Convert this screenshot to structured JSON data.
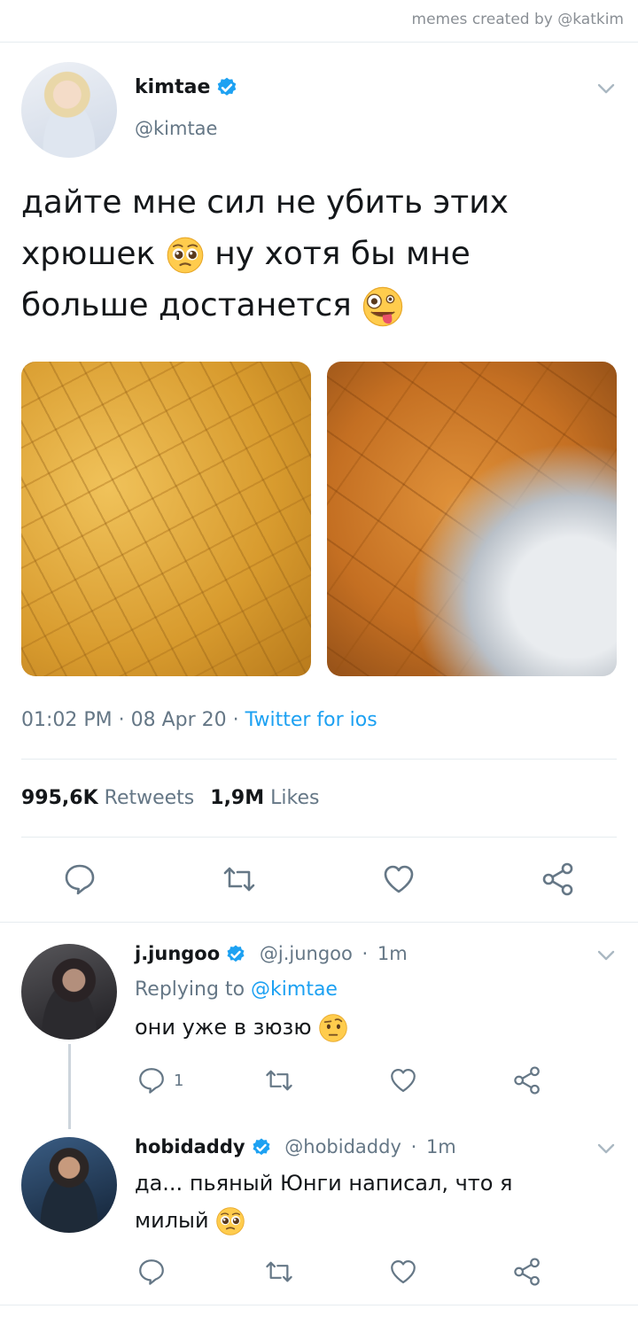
{
  "credit": "memes created by @katkim",
  "tweet": {
    "name": "kimtae",
    "handle": "@kimtae",
    "text_line1": "дайте мне сил не убить этих",
    "text_line2a": "хрюшек",
    "text_line2b": "ну хотя бы мне",
    "text_line3": "больше достанется",
    "time": "01:02 PM",
    "date": "08 Apr 20",
    "source": "Twitter for ios",
    "retweets_count": "995,6K",
    "retweets_label": "Retweets",
    "likes_count": "1,9M",
    "likes_label": "Likes"
  },
  "replies": [
    {
      "name": "j.jungoo",
      "handle": "@j.jungoo",
      "age": "1m",
      "replying_label": "Replying to",
      "replying_to": "@kimtae",
      "text": "они уже в зюзю",
      "reply_count": "1"
    },
    {
      "name": "hobidaddy",
      "handle": "@hobidaddy",
      "age": "1m",
      "text_line1": "да... пьяный Юнги написал, что я",
      "text_line2": "милый"
    }
  ],
  "icons": {
    "verified": "verified-badge-icon",
    "reply": "reply-icon",
    "retweet": "retweet-icon",
    "like": "heart-icon",
    "share": "share-icon",
    "more": "chevron-down-icon",
    "emoji_pleading": "pleading-face-emoji",
    "emoji_zany": "zany-face-emoji",
    "emoji_raised_brow": "raised-eyebrow-emoji"
  },
  "colors": {
    "accent": "#1da1f2",
    "muted": "#657786",
    "divider": "#e6ecf0"
  }
}
